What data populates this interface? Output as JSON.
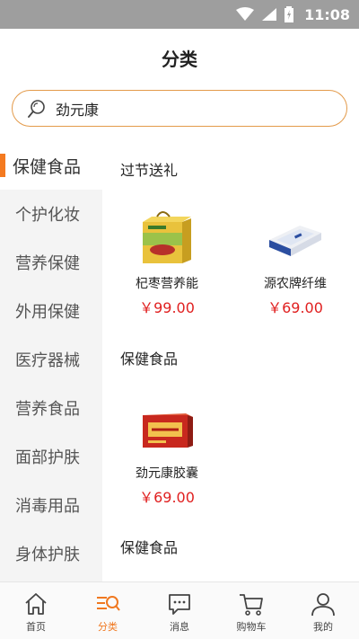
{
  "status": {
    "time": "11:08"
  },
  "header": {
    "title": "分类"
  },
  "search": {
    "value": "劲元康"
  },
  "sidebar": {
    "items": [
      {
        "label": "保健食品",
        "active": true
      },
      {
        "label": "个护化妆"
      },
      {
        "label": "营养保健"
      },
      {
        "label": "外用保健"
      },
      {
        "label": "医疗器械"
      },
      {
        "label": "营养食品"
      },
      {
        "label": "面部护肤"
      },
      {
        "label": "消毒用品"
      },
      {
        "label": "身体护肤"
      }
    ]
  },
  "content": {
    "sections": [
      {
        "title": "过节送礼"
      },
      {
        "title": "保健食品"
      },
      {
        "title": "保健食品"
      }
    ],
    "products": [
      {
        "name": "杞枣营养能",
        "price": "￥99.00",
        "image_icon": "gift-box-icon"
      },
      {
        "name": "源农牌纤维",
        "price": "￥69.00",
        "image_icon": "white-box-icon"
      },
      {
        "name": "劲元康胶囊",
        "price": "￥69.00",
        "image_icon": "red-box-icon"
      }
    ]
  },
  "tabbar": {
    "items": [
      {
        "label": "首页",
        "icon": "home-icon"
      },
      {
        "label": "分类",
        "icon": "category-icon",
        "active": true
      },
      {
        "label": "消息",
        "icon": "message-icon"
      },
      {
        "label": "购物车",
        "icon": "cart-icon"
      },
      {
        "label": "我的",
        "icon": "user-icon"
      }
    ]
  },
  "colors": {
    "accent": "#f47a20",
    "price": "#e02020",
    "search_border": "#e39a4a",
    "statusbar": "#9e9e9e"
  }
}
